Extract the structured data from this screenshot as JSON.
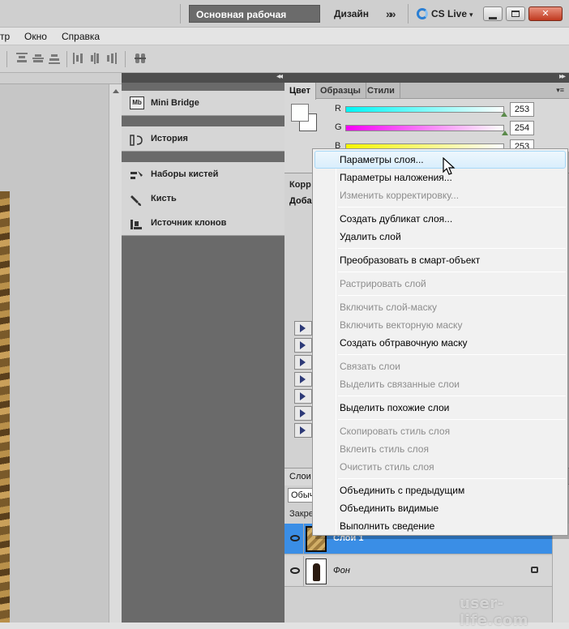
{
  "titlebar": {
    "workspace_basic": "Основная рабочая среда",
    "workspace_design": "Дизайн",
    "more_glyph": "»",
    "cslive": "CS Live",
    "cslive_caret": "▾",
    "min_glyph": "▭",
    "max_glyph": "▭",
    "close_glyph": "✕"
  },
  "menubar": {
    "items": [
      "тр",
      "Окно",
      "Справка"
    ]
  },
  "dock": {
    "groups": [
      [
        {
          "label": "Mini Bridge",
          "icon": "mini-bridge-icon"
        }
      ],
      [
        {
          "label": "История",
          "icon": "history-icon"
        }
      ],
      [
        {
          "label": "Наборы кистей",
          "icon": "brush-presets-icon"
        },
        {
          "label": "Кисть",
          "icon": "brush-icon"
        },
        {
          "label": "Источник клонов",
          "icon": "clone-source-icon"
        }
      ]
    ]
  },
  "color_panel": {
    "tabs": [
      "Цвет",
      "Образцы",
      "Стили"
    ],
    "menu_glyph": "▾≡",
    "channels": [
      {
        "label": "R",
        "value": "253",
        "color": "#00e6e6"
      },
      {
        "label": "G",
        "value": "254",
        "color": "#e600e6"
      },
      {
        "label": "B",
        "value": "253",
        "color": "#e6e600"
      }
    ]
  },
  "adjustments_panel": {
    "tab": "Корр",
    "subtitle": "Доба",
    "row_count": 7
  },
  "layers_panel": {
    "tab": "Слои",
    "blend_mode": "Обыч",
    "lock_label": "Закре",
    "layers": [
      {
        "name": "Слой 1",
        "selected": true
      },
      {
        "name": "Фон",
        "selected": false,
        "locked": true
      }
    ]
  },
  "context_menu": {
    "items": [
      {
        "label": "Параметры слоя...",
        "enabled": true,
        "highlighted": true
      },
      {
        "label": "Параметры наложения...",
        "enabled": true
      },
      {
        "label": "Изменить корректировку...",
        "enabled": false
      },
      {
        "separator": true
      },
      {
        "label": "Создать дубликат слоя...",
        "enabled": true
      },
      {
        "label": "Удалить слой",
        "enabled": true
      },
      {
        "separator": true
      },
      {
        "label": "Преобразовать в смарт-объект",
        "enabled": true
      },
      {
        "separator": true
      },
      {
        "label": "Растрировать слой",
        "enabled": false
      },
      {
        "separator": true
      },
      {
        "label": "Включить слой-маску",
        "enabled": false
      },
      {
        "label": "Включить векторную маску",
        "enabled": false
      },
      {
        "label": "Создать обтравочную маску",
        "enabled": true
      },
      {
        "separator": true
      },
      {
        "label": "Связать слои",
        "enabled": false
      },
      {
        "label": "Выделить связанные слои",
        "enabled": false
      },
      {
        "separator": true
      },
      {
        "label": "Выделить похожие слои",
        "enabled": true
      },
      {
        "separator": true
      },
      {
        "label": "Скопировать стиль слоя",
        "enabled": false
      },
      {
        "label": "Вклеить стиль слоя",
        "enabled": false
      },
      {
        "label": "Очистить стиль слоя",
        "enabled": false
      },
      {
        "separator": true
      },
      {
        "label": "Объединить с предыдущим",
        "enabled": true
      },
      {
        "label": "Объединить видимые",
        "enabled": true
      },
      {
        "label": "Выполнить сведение",
        "enabled": true
      }
    ]
  },
  "watermark": "user-life.com"
}
